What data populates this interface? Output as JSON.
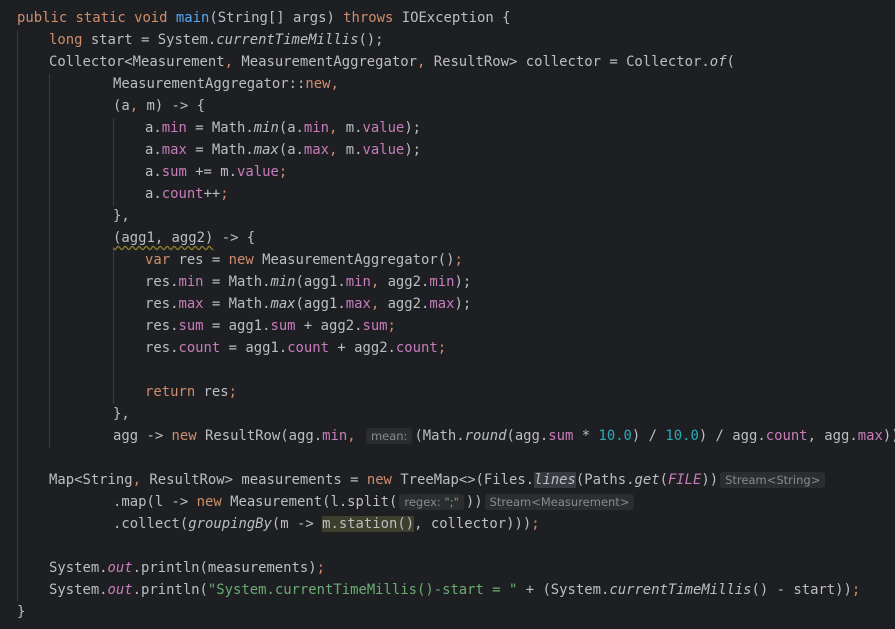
{
  "colors": {
    "background": "#1e1f22",
    "keyword": "#cf8e6d",
    "method_decl": "#56a8f5",
    "field": "#c77dbb",
    "number": "#2aacb8",
    "string": "#6aab73",
    "text": "#bcbec4"
  },
  "code": {
    "l1": {
      "a": "public static void ",
      "b": "main",
      "c": "(String[] args) ",
      "d": "throws",
      "e": " IOException {"
    },
    "l2": {
      "a": "long",
      "b": " start = System.",
      "c": "currentTimeMillis",
      "d": "();"
    },
    "l3": {
      "a": "Collector<Measurement",
      "b": ",",
      "c": " MeasurementAggregator",
      "d": ",",
      "e": " ResultRow> collector = Collector.",
      "f": "of",
      "g": "("
    },
    "l4": {
      "a": "MeasurementAggregator::",
      "b": "new",
      "c": ","
    },
    "l5": {
      "a": "(a",
      "b": ",",
      "c": " m) -> {"
    },
    "l6": {
      "a": "a.",
      "b": "min",
      "c": " = Math.",
      "d": "min",
      "e": "(a.",
      "f": "min",
      "g": ",",
      "h": " m.",
      "i": "value",
      "j": ");"
    },
    "l7": {
      "a": "a.",
      "b": "max",
      "c": " = Math.",
      "d": "max",
      "e": "(a.",
      "f": "max",
      "g": ",",
      "h": " m.",
      "i": "value",
      "j": ");"
    },
    "l8": {
      "a": "a.",
      "b": "sum",
      "c": " += m.",
      "d": "value",
      "e": ";"
    },
    "l9": {
      "a": "a.",
      "b": "count",
      "c": "++",
      "d": ";"
    },
    "l10": {
      "a": "},"
    },
    "l11": {
      "a": "(agg1, agg2)",
      "b": " -> {"
    },
    "l12": {
      "a": "var",
      "b": " res = ",
      "c": "new",
      "d": " MeasurementAggregator()",
      "e": ";"
    },
    "l13": {
      "a": "res.",
      "b": "min",
      "c": " = Math.",
      "d": "min",
      "e": "(agg1.",
      "f": "min",
      "g": ",",
      "h": " agg2.",
      "i": "min",
      "j": ");"
    },
    "l14": {
      "a": "res.",
      "b": "max",
      "c": " = Math.",
      "d": "max",
      "e": "(agg1.",
      "f": "max",
      "g": ",",
      "h": " agg2.",
      "i": "max",
      "j": ");"
    },
    "l15": {
      "a": "res.",
      "b": "sum",
      "c": " = agg1.",
      "d": "sum",
      "e": " + agg2.",
      "f": "sum",
      "g": ";"
    },
    "l16": {
      "a": "res.",
      "b": "count",
      "c": " = agg1.",
      "d": "count",
      "e": " + agg2.",
      "f": "count",
      "g": ";"
    },
    "l17": {
      "a": "return",
      "b": " res",
      "c": ";"
    },
    "l18": {
      "a": "},"
    },
    "l19": {
      "a": "agg -> ",
      "b": "new",
      "c": " ResultRow(agg.",
      "d": "min",
      "e": ",",
      "hint_label": "mean:",
      "f": "(Math.",
      "g": "round",
      "h": "(agg.",
      "i": "sum",
      "j": " * ",
      "k": "10.0",
      "l": ") / ",
      "m": "10.0",
      "n": ") / agg.",
      "o": "count",
      "p": ", agg.",
      "q": "max",
      "r": "));"
    },
    "l20": {
      "a": "Map<String",
      "b": ",",
      "c": " ResultRow> measurements = ",
      "d": "new",
      "e": " TreeMap<>(Files.",
      "f": "lines",
      "g": "(Paths.",
      "h": "get",
      "i": "(",
      "j": "FILE",
      "k": "))",
      "hint": "Stream<String>"
    },
    "l21": {
      "a": ".map(l -> ",
      "b": "new",
      "c": " Measurement(l.split(",
      "hint_label": "regex:",
      "hint_value": "\";\"",
      "d": "))",
      "hint": "Stream<Measurement>"
    },
    "l22": {
      "a": ".collect(",
      "b": "groupingBy",
      "c": "(m -> ",
      "d": "m.station()",
      "e": ", collector)))",
      "f": ";"
    },
    "l23": {
      "a": "System.",
      "b": "out",
      "c": ".println(measurements)",
      "d": ";"
    },
    "l24": {
      "a": "System.",
      "b": "out",
      "c": ".println(",
      "d": "\"System.currentTimeMillis()-start = \"",
      "e": " + (System.",
      "f": "currentTimeMillis",
      "g": "() - start))",
      "h": ";"
    },
    "l25": {
      "a": "}"
    }
  }
}
